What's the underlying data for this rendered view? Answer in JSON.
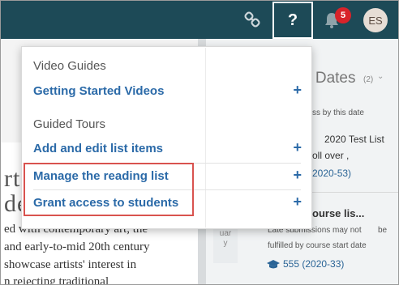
{
  "topbar": {
    "link_icon": "link-icon",
    "help_label": "?",
    "bell_icon": "bell-icon",
    "notification_count": "5",
    "avatar_initials": "ES",
    "colors": {
      "bar": "#1d4a57",
      "badge": "#d8232a"
    }
  },
  "dropdown": {
    "section_video": "Video Guides",
    "getting_started": "Getting Started Videos",
    "section_tours": "Guided Tours",
    "add_edit": "Add and edit list items",
    "manage_reading": "Manage the reading list",
    "grant_access": "Grant access to students",
    "plus": "+",
    "link_color": "#2b6aa8"
  },
  "right_panel": {
    "title": "e Dates",
    "count": "(2)",
    "chevron": "⌄",
    "line1": "ss by this date",
    "line2": "2020 Test List",
    "line3": "oll over ,",
    "line4": "2020-53)",
    "item2_title": "ourse lis...",
    "item2_note1": "Late submissions may not",
    "item2_note2": "be",
    "item2_note3": "fulfilled by course start date",
    "item2_code": "555 (2020-33)",
    "cap_icon": "graduation-cap-icon"
  },
  "date_col": {
    "l1": "ebr",
    "l2": "uar",
    "l3": "y"
  },
  "left_page": {
    "heading1": "rt '",
    "heading2": "de",
    "line1": "ed with contemporary art, the",
    "line2": "and early-to-mid 20th century",
    "line3": "showcase artists' interest in",
    "line4": "n rejecting traditional"
  }
}
